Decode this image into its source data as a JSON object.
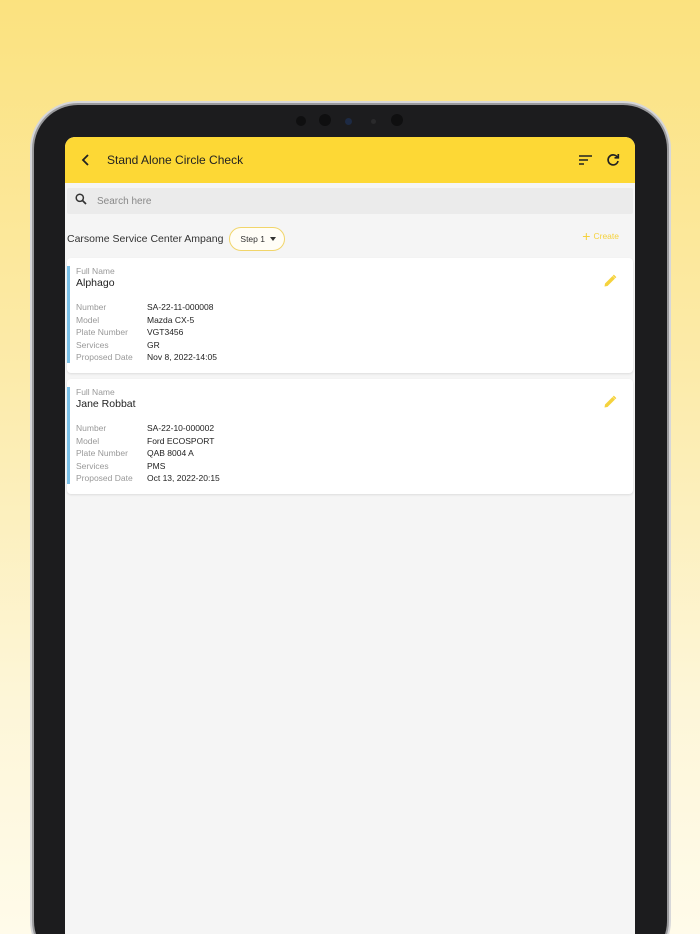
{
  "appbar": {
    "title": "Stand Alone Circle Check"
  },
  "search": {
    "placeholder": "Search here"
  },
  "filters": {
    "service_center": "Carsome Service Center Ampang",
    "step": "Step 1",
    "create_label": "Create"
  },
  "colors": {
    "accent": "#fdd835",
    "card_bar": "#7ac0e8",
    "create": "#f5d23d"
  },
  "labels": {
    "full_name": "Full Name",
    "number": "Number",
    "model": "Model",
    "plate_number": "Plate Number",
    "services": "Services",
    "proposed_date": "Proposed Date"
  },
  "records": [
    {
      "full_name": "Alphago",
      "number": "SA-22-11-000008",
      "model": "Mazda CX-5",
      "plate_number": "VGT3456",
      "services": "GR",
      "proposed_date": "Nov 8, 2022-14:05"
    },
    {
      "full_name": "Jane Robbat",
      "number": "SA-22-10-000002",
      "model": "Ford ECOSPORT",
      "plate_number": "QAB 8004 A",
      "services": "PMS",
      "proposed_date": "Oct 13, 2022-20:15"
    }
  ]
}
